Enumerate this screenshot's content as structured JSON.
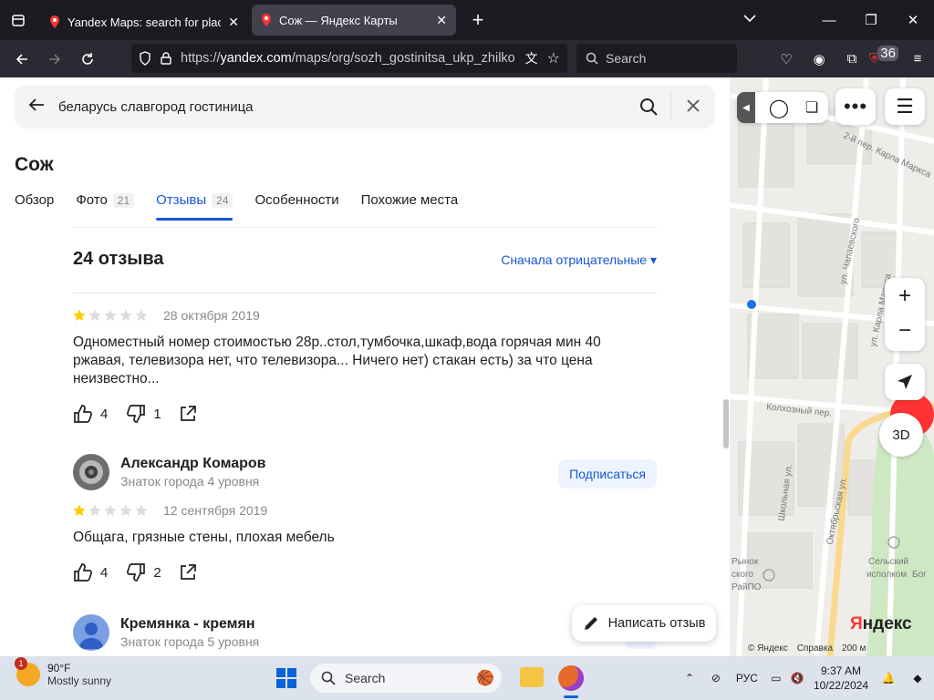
{
  "browser": {
    "tabs": [
      {
        "title": "Yandex Maps: search for places,",
        "active": false
      },
      {
        "title": "Сож — Яндекс Карты",
        "active": true
      }
    ],
    "url_prefix": "https://",
    "url_main": "yandex.com",
    "url_rest": "/maps/org/sozh_gostinitsa_ukp_zhilko",
    "search_placeholder": "Search",
    "extensions_badge": "36"
  },
  "search": {
    "query": "беларусь славгород гостиница"
  },
  "org": {
    "name": "Сож",
    "tabs": [
      {
        "label": "Обзор",
        "count": ""
      },
      {
        "label": "Фото",
        "count": "21"
      },
      {
        "label": "Отзывы",
        "count": "24"
      },
      {
        "label": "Особенности",
        "count": ""
      },
      {
        "label": "Похожие места",
        "count": ""
      }
    ]
  },
  "reviews": {
    "header": "24 отзыва",
    "sort_label": "Сначала отрицательные",
    "items": [
      {
        "rating": 1,
        "date": "28 октября 2019",
        "text": "Одноместный номер стоимостью 28р..стол,тумбочка,шкаф,вода горячая мин 40 ржавая, телевизора нет, что телевизора... Ничего нет) стакан есть) за что цена неизвестно...",
        "likes": "4",
        "dislikes": "1"
      },
      {
        "author": "Александр Комаров",
        "level": "Знаток города 4 уровня",
        "subscribe": "Подписаться",
        "rating": 1,
        "date": "12 сентября 2019",
        "text": "Общага, грязные стены, плохая мебель",
        "likes": "4",
        "dislikes": "2"
      },
      {
        "author": "Кремянка - кремян",
        "level": "Знаток города 5 уровня",
        "subscribe": "П"
      }
    ],
    "write_review": "Написать отзыв"
  },
  "map": {
    "streets": [
      "2-й пер. Карла Маркса",
      "ул. Чапаевского",
      "ул. Карла Маркса",
      "Колхозный пер.",
      "Школьная ул.",
      "Октябрьская ул.",
      "Рынок",
      "ского",
      "РайПО",
      "Сельский",
      "исполком",
      "Бог"
    ],
    "zoom_in": "+",
    "zoom_out": "−",
    "mode_3d": "3D",
    "logo_main": "Я",
    "logo_rest": "ндекс",
    "copyright": "© Яндекс",
    "help": "Справка",
    "scale": "200 м"
  },
  "taskbar": {
    "weather_temp": "90°F",
    "weather_desc": "Mostly sunny",
    "weather_badge": "1",
    "search_label": "Search",
    "language": "РУС",
    "time": "9:37 AM",
    "date": "10/22/2024"
  },
  "colors": {
    "accent": "#1956d4",
    "star_filled": "#fc0",
    "star_empty": "#ddd"
  }
}
